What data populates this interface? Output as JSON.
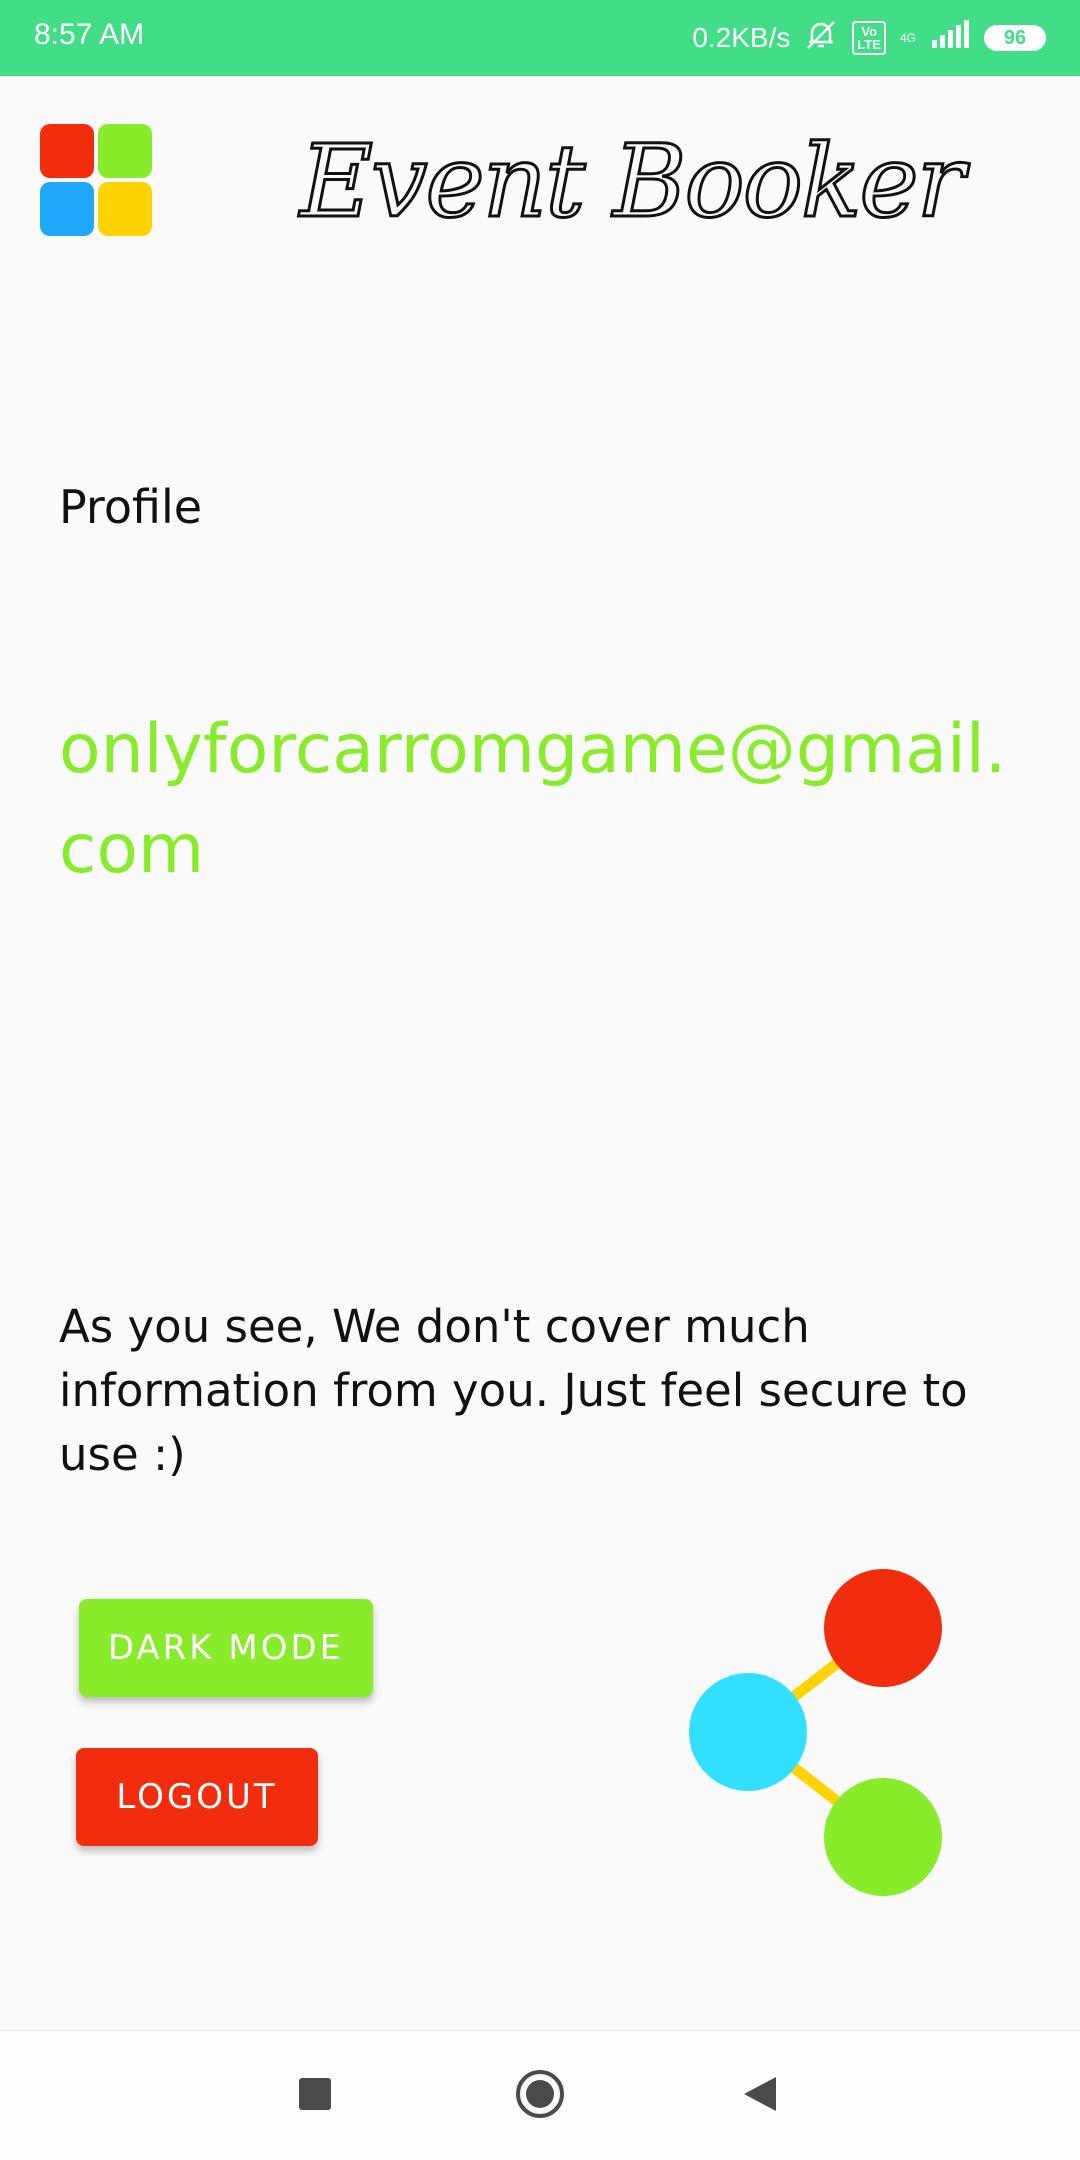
{
  "status_bar": {
    "time": "8:57 AM",
    "net_speed": "0.2KB/s",
    "volte": "Vo\nLTE",
    "network": "4G",
    "battery": "96"
  },
  "header": {
    "title": "Event Booker",
    "logo_colors": [
      "#f22d0e",
      "#88ec2a",
      "#1fa8fa",
      "#ffd302"
    ]
  },
  "profile": {
    "section_title": "Profile",
    "email": "onlyforcarromgame@gmail.com",
    "info": "As you see, We don't cover much information from you. Just feel secure to use :)"
  },
  "actions": {
    "dark_mode_label": "DARK MODE",
    "logout_label": "LOGOUT"
  },
  "colors": {
    "accent_green": "#88ec2a",
    "accent_red": "#f22d0e",
    "accent_cyan": "#33dfff",
    "accent_yellow": "#ffd302",
    "status_bar": "#42dd87"
  },
  "icons": {
    "share": "share-icon",
    "nav_recents": "square-icon",
    "nav_home": "circle-icon",
    "nav_back": "triangle-back-icon"
  }
}
